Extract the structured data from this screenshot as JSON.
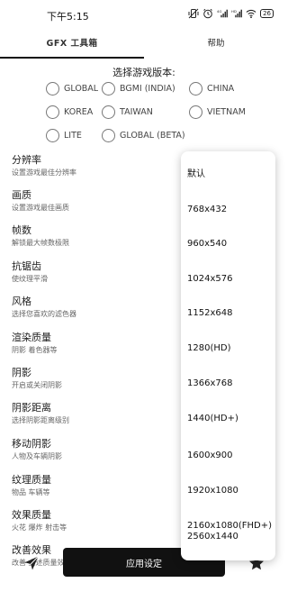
{
  "status": {
    "time": "下午5:15",
    "battery": "26"
  },
  "tabs": {
    "main": "GFX 工具箱",
    "help": "帮助"
  },
  "version": {
    "title": "选择游戏版本:",
    "options": [
      "GLOBAL",
      "BGMI (INDIA)",
      "CHINA",
      "KOREA",
      "TAIWAN",
      "VIETNAM",
      "LITE",
      "GLOBAL (BETA)"
    ]
  },
  "settings": [
    {
      "title": "分辨率",
      "subtitle": "设置游戏最佳分辨率"
    },
    {
      "title": "画质",
      "subtitle": "设置游戏最佳画质"
    },
    {
      "title": "帧数",
      "subtitle": "解锁最大帧数极限"
    },
    {
      "title": "抗锯齿",
      "subtitle": "使纹理平滑"
    },
    {
      "title": "风格",
      "subtitle": "选择您喜欢的滤色器"
    },
    {
      "title": "渲染质量",
      "subtitle": "阴影 着色器等"
    },
    {
      "title": "阴影",
      "subtitle": "开启或关闭阴影"
    },
    {
      "title": "阴影距离",
      "subtitle": "选择阴影距离级别"
    },
    {
      "title": "移动阴影",
      "subtitle": "人物及车辆阴影"
    },
    {
      "title": "纹理质量",
      "subtitle": "物品 车辆等"
    },
    {
      "title": "效果质量",
      "subtitle": "火花 爆炸 射击等"
    },
    {
      "title": "改善效果",
      "subtitle": "改善 上述质量效果"
    }
  ],
  "resolution_menu": [
    "默认",
    "768x432",
    "960x540",
    "1024x576",
    "1152x648",
    "1280(HD)",
    "1366x768",
    "1440(HD+)",
    "1600x900",
    "1920x1080",
    "2160x1080(FHD+)",
    "2560x1440"
  ],
  "bottom": {
    "apply_label": "应用设定"
  }
}
